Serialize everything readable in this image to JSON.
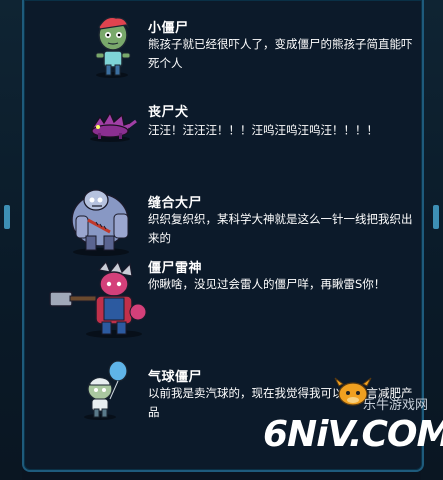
{
  "entries": [
    {
      "name": "小僵尸",
      "desc": "熊孩子就已经很吓人了，变成僵尸的熊孩子简直能吓死个人",
      "icon": "kid-zombie-icon"
    },
    {
      "name": "丧尸犬",
      "desc": "汪汪！汪汪汪！！！汪呜汪呜汪呜汪！！！！",
      "icon": "zombie-dog-icon"
    },
    {
      "name": "缝合大尸",
      "desc": "织织复织织，某科学大神就是这么一针一线把我织出来的",
      "icon": "stitched-zombie-icon"
    },
    {
      "name": "僵尸雷神",
      "desc": "你瞅啥，没见过会雷人的僵尸咩，再瞅雷S你！",
      "icon": "thunder-zombie-icon"
    },
    {
      "name": "气球僵尸",
      "desc": "以前我是卖汽球的，现在我觉得我可以去代言减肥产品",
      "icon": "balloon-zombie-icon"
    }
  ],
  "watermark": {
    "small": "乐牛游戏网",
    "big": "6NiV.COM"
  },
  "colors": {
    "panel_bg": "#0c1a2a",
    "border": "#1e5b7c",
    "text": "#ffffff"
  }
}
